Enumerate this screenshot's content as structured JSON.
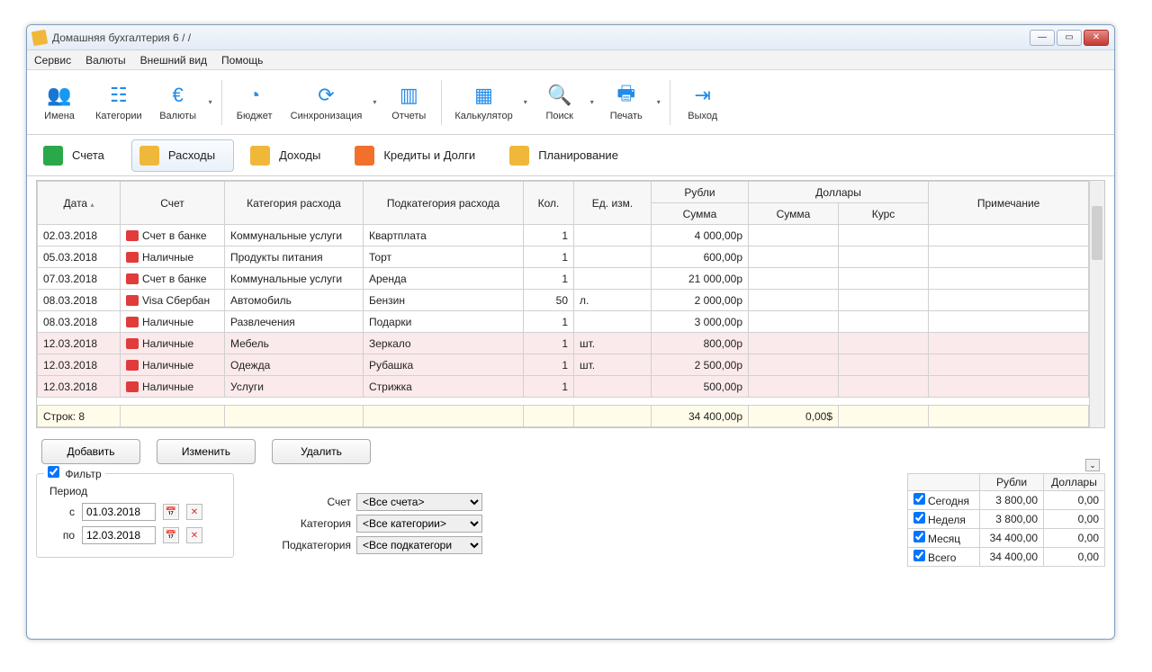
{
  "title": "Домашняя бухгалтерия 6  /                /",
  "menu": [
    "Сервис",
    "Валюты",
    "Внешний вид",
    "Помощь"
  ],
  "toolbar": [
    {
      "icon": "👥",
      "label": "Имена"
    },
    {
      "icon": "☷",
      "label": "Категории"
    },
    {
      "icon": "€",
      "label": "Валюты",
      "dd": true
    },
    {
      "sep": true
    },
    {
      "icon": "◔",
      "label": "Бюджет"
    },
    {
      "icon": "⟳",
      "label": "Синхронизация",
      "dd": true
    },
    {
      "icon": "▥",
      "label": "Отчеты"
    },
    {
      "sep": true
    },
    {
      "icon": "▦",
      "label": "Калькулятор",
      "dd": true
    },
    {
      "icon": "🔍",
      "label": "Поиск",
      "dd": true
    },
    {
      "icon": "🖶",
      "label": "Печать",
      "dd": true
    },
    {
      "sep": true
    },
    {
      "icon": "⇥",
      "label": "Выход"
    }
  ],
  "tabs": [
    {
      "label": "Счета",
      "color": "#2aa84a"
    },
    {
      "label": "Расходы",
      "color": "#f0b83a",
      "active": true
    },
    {
      "label": "Доходы",
      "color": "#f0b83a"
    },
    {
      "label": "Кредиты и Долги",
      "color": "#f26f2c"
    },
    {
      "label": "Планирование",
      "color": "#f0b83a"
    }
  ],
  "columns": {
    "date": "Дата",
    "account": "Счет",
    "category": "Категория расхода",
    "subcategory": "Подкатегория расхода",
    "qty": "Кол.",
    "unit": "Ед. изм.",
    "rub": "Рубли",
    "usd": "Доллары",
    "sum": "Сумма",
    "rate": "Курс",
    "note": "Примечание"
  },
  "rows": [
    {
      "date": "02.03.2018",
      "icon": "bank",
      "account": "Счет в банке",
      "category": "Коммунальные услуги",
      "sub": "Квартплата",
      "qty": "1",
      "unit": "",
      "rub": "4 000,00р"
    },
    {
      "date": "05.03.2018",
      "icon": "cash",
      "account": "Наличные",
      "category": "Продукты питания",
      "sub": "Торт",
      "qty": "1",
      "unit": "",
      "rub": "600,00р"
    },
    {
      "date": "07.03.2018",
      "icon": "bank",
      "account": "Счет в банке",
      "category": "Коммунальные услуги",
      "sub": "Аренда",
      "qty": "1",
      "unit": "",
      "rub": "21 000,00р"
    },
    {
      "date": "08.03.2018",
      "icon": "visa",
      "account": "Visa Сбербан",
      "category": "Автомобиль",
      "sub": "Бензин",
      "qty": "50",
      "unit": "л.",
      "rub": "2 000,00р"
    },
    {
      "date": "08.03.2018",
      "icon": "cash",
      "account": "Наличные",
      "category": "Развлечения",
      "sub": "Подарки",
      "qty": "1",
      "unit": "",
      "rub": "3 000,00р"
    },
    {
      "date": "12.03.2018",
      "icon": "cash",
      "account": "Наличные",
      "category": "Мебель",
      "sub": "Зеркало",
      "qty": "1",
      "unit": "шт.",
      "rub": "800,00р",
      "pink": true
    },
    {
      "date": "12.03.2018",
      "icon": "cash",
      "account": "Наличные",
      "category": "Одежда",
      "sub": "Рубашка",
      "qty": "1",
      "unit": "шт.",
      "rub": "2 500,00р",
      "pink": true
    },
    {
      "date": "12.03.2018",
      "icon": "cash",
      "account": "Наличные",
      "category": "Услуги",
      "sub": "Стрижка",
      "qty": "1",
      "unit": "",
      "rub": "500,00р",
      "pink": true
    }
  ],
  "summary_row": {
    "label": "Строк: 8",
    "rub": "34 400,00р",
    "usd": "0,00$"
  },
  "buttons": {
    "add": "Добавить",
    "edit": "Изменить",
    "delete": "Удалить"
  },
  "filter": {
    "title": "Фильтр",
    "period": "Период",
    "from": "с",
    "to": "по",
    "from_date": "01.03.2018",
    "to_date": "12.03.2018",
    "account": "Счет",
    "category": "Категория",
    "subcategory": "Подкатегория",
    "account_val": "<Все счета>",
    "category_val": "<Все категории>",
    "subcategory_val": "<Все подкатегори"
  },
  "totals": {
    "headers": [
      "",
      "Рубли",
      "Доллары"
    ],
    "rows": [
      {
        "label": "Сегодня",
        "rub": "3 800,00",
        "usd": "0,00"
      },
      {
        "label": "Неделя",
        "rub": "3 800,00",
        "usd": "0,00"
      },
      {
        "label": "Месяц",
        "rub": "34 400,00",
        "usd": "0,00"
      },
      {
        "label": "Всего",
        "rub": "34 400,00",
        "usd": "0,00"
      }
    ]
  }
}
